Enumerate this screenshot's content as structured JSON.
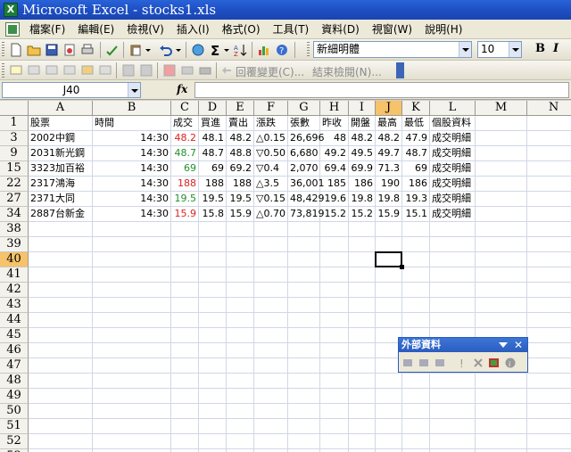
{
  "window": {
    "title": "Microsoft Excel - stocks1.xls"
  },
  "menu": [
    "檔案(F)",
    "編輯(E)",
    "檢視(V)",
    "插入(I)",
    "格式(O)",
    "工具(T)",
    "資料(D)",
    "視窗(W)",
    "說明(H)"
  ],
  "toolbar": {
    "font_name": "新細明體",
    "font_size": "10",
    "bold_label": "B",
    "italic_label": "I"
  },
  "review_toolbar": {
    "reply_label": "回覆變更(C)...",
    "end_review_label": "結束檢閱(N)..."
  },
  "formula_bar": {
    "name_box": "J40",
    "fx_label": "fx",
    "content": ""
  },
  "grid": {
    "columns": [
      "A",
      "B",
      "C",
      "D",
      "E",
      "F",
      "G",
      "H",
      "I",
      "J",
      "K",
      "L",
      "M",
      "N"
    ],
    "active_column": "J",
    "active_row": "40",
    "rows": [
      "1",
      "3",
      "9",
      "15",
      "22",
      "27",
      "34",
      "38",
      "39",
      "40",
      "41",
      "42",
      "43",
      "44",
      "45",
      "46",
      "47",
      "48",
      "49",
      "50",
      "51",
      "52",
      "53"
    ],
    "header_row": [
      "股票",
      "時間",
      "成交",
      "買進",
      "賣出",
      "漲跌",
      "張數",
      "昨收",
      "開盤",
      "最高",
      "最低",
      "個股資料"
    ],
    "data_rows": [
      [
        "2002中鋼",
        "14:30",
        "48.2",
        "48.1",
        "48.2",
        "△0.15",
        "26,696",
        "48",
        "48.2",
        "48.2",
        "47.9",
        "成交明細"
      ],
      [
        "2031新光鋼",
        "14:30",
        "48.7",
        "48.7",
        "48.8",
        "▽0.50",
        "6,680",
        "49.2",
        "49.5",
        "49.7",
        "48.7",
        "成交明細"
      ],
      [
        "3323加百裕",
        "14:30",
        "69",
        "69",
        "69.2",
        "▽0.4",
        "2,070",
        "69.4",
        "69.9",
        "71.3",
        "69",
        "成交明細"
      ],
      [
        "2317鴻海",
        "14:30",
        "188",
        "188",
        "188",
        "△3.5",
        "36,001",
        "185",
        "186",
        "190",
        "186",
        "成交明細"
      ],
      [
        "2371大同",
        "14:30",
        "19.5",
        "19.5",
        "19.5",
        "▽0.15",
        "48,429",
        "19.6",
        "19.8",
        "19.8",
        "19.3",
        "成交明細"
      ],
      [
        "2887台新金",
        "14:30",
        "15.9",
        "15.8",
        "15.9",
        "△0.70",
        "73,819",
        "15.2",
        "15.2",
        "15.9",
        "15.1",
        "成交明細"
      ]
    ],
    "trade_colors": [
      "red",
      "green",
      "green",
      "red",
      "green",
      "red"
    ]
  },
  "colors": {
    "up": "#e02020",
    "down": "#20902a",
    "title_bar": "#1d4fc4",
    "active_header": "#f6c26a"
  },
  "external_data_toolbar": {
    "title": "外部資料"
  }
}
